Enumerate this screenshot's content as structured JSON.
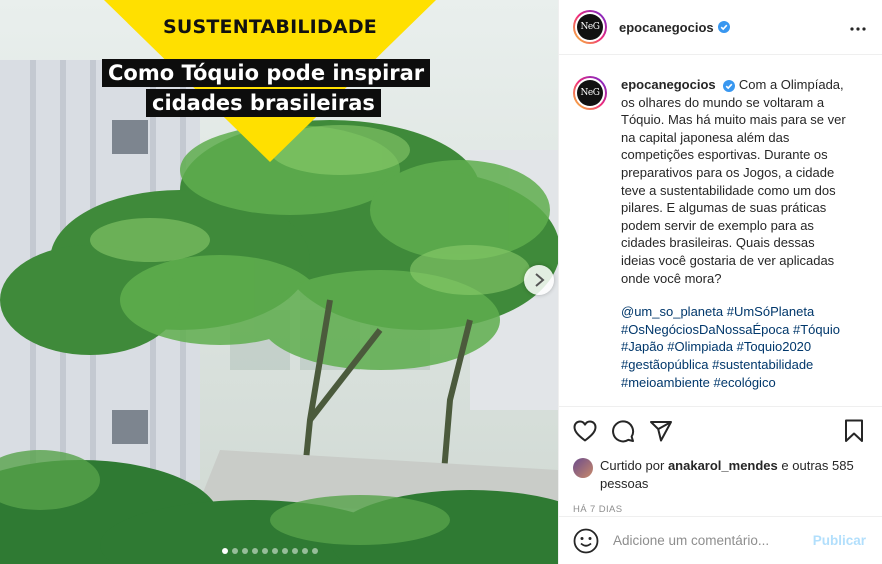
{
  "post": {
    "image": {
      "tag": "SUSTENTABILIDADE",
      "headline_line1": "Como Tóquio pode inspirar",
      "headline_line2": "cidades brasileiras",
      "accent_color": "#ffe000",
      "next_icon": "chevron-right-icon",
      "slides": 10,
      "active_slide": 1
    },
    "author": {
      "username": "epocanegocios",
      "avatar_text": "NeG",
      "verified": true
    },
    "more_icon": "ellipsis-icon",
    "caption": {
      "username": "epocanegocios",
      "text": "Com a Olimpíada, os olhares do mundo se voltaram a Tóquio. Mas há muito mais para se ver na capital japonesa além das competições esportivas. Durante os preparativos para os Jogos, a cidade teve a sustentabilidade como um dos pilares. E algumas de suas práticas podem servir de exemplo para as cidades brasileiras. Quais dessas ideias você gostaria de ver aplicadas onde você mora?",
      "tags": [
        "@um_so_planeta",
        "#UmSóPlaneta",
        "#OsNegóciosDaNossaÉpoca",
        "#Tóquio",
        "#Japão",
        "#Olimpiada",
        "#Toquio2020",
        "#gestãopública",
        "#sustentabilidade",
        "#meioambiente",
        "#ecológico"
      ]
    },
    "actions": {
      "like_icon": "heart-icon",
      "comment_icon": "comment-icon",
      "share_icon": "share-icon",
      "save_icon": "bookmark-icon"
    },
    "likes": {
      "prefix": "Curtido por",
      "user": "anakarol_mendes",
      "suffix": "e outras 585 pessoas"
    },
    "timestamp": "HÁ 7 DIAS",
    "comment": {
      "emoji_icon": "smiley-icon",
      "placeholder": "Adicione um comentário...",
      "publish_label": "Publicar",
      "publish_color": "#b2dffc"
    },
    "link_color": "#00376b",
    "verified_color": "#3897f0"
  }
}
